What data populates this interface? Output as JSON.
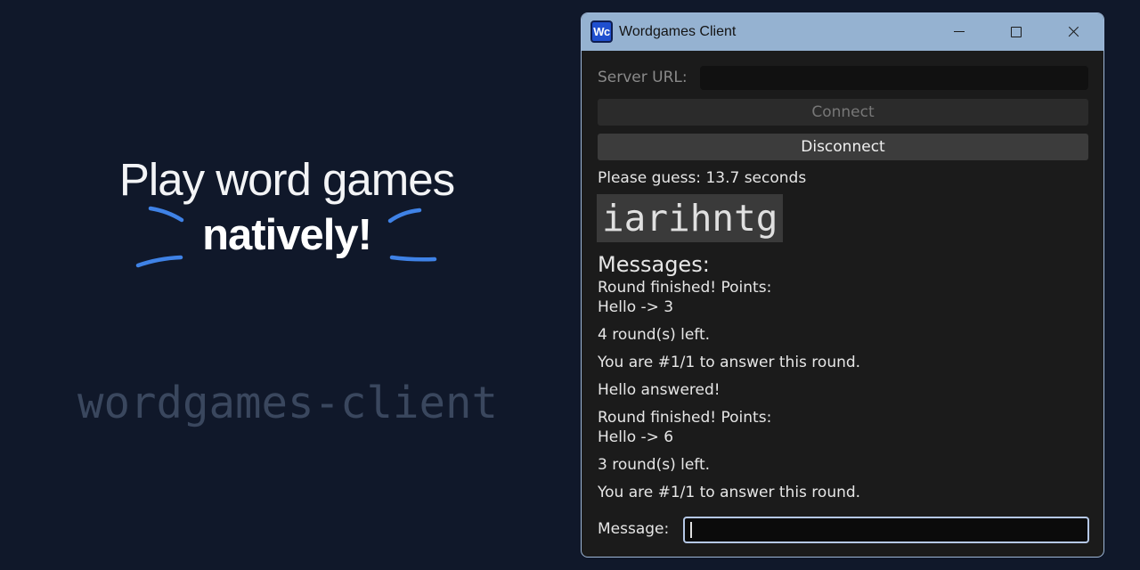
{
  "hero": {
    "line1": "Play word games",
    "line2": "natively!",
    "project_name": "wordgames-client"
  },
  "colors": {
    "page_bg": "#10182a",
    "accent": "#3f82e6",
    "titlebar": "#95b2d1",
    "window_bg": "#1b1b1b"
  },
  "window": {
    "title": "Wordgames Client",
    "app_icon_text": "Wc",
    "controls": [
      "minimize-icon",
      "maximize-icon",
      "close-icon"
    ]
  },
  "client": {
    "server_url_label": "Server URL:",
    "server_url_value": "",
    "connect_label": "Connect",
    "disconnect_label": "Disconnect",
    "status": "Please guess: 13.7 seconds",
    "scramble": "iarihntg",
    "messages_heading": "Messages:",
    "messages": [
      "Round finished! Points:",
      "Hello -> 3",
      "4 round(s) left.",
      "You are #1/1 to answer this round.",
      "Hello answered!",
      "Round finished! Points:",
      "Hello -> 6",
      "3 round(s) left.",
      "You are #1/1 to answer this round."
    ],
    "message_label": "Message:",
    "message_value": ""
  }
}
